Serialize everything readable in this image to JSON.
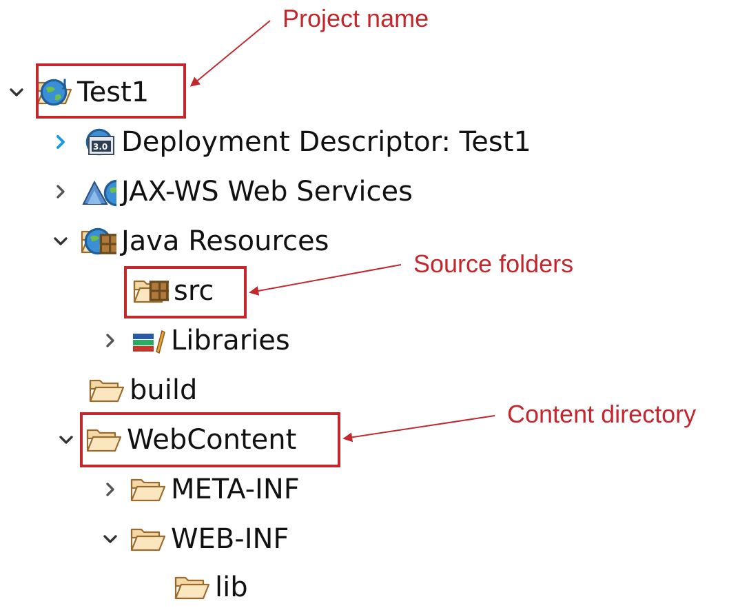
{
  "tree": {
    "items": [
      {
        "label": "Test1",
        "icon": "java-web-project-icon",
        "expander": "expanded"
      },
      {
        "label": "Deployment Descriptor: Test1",
        "icon": "deployment-descriptor-icon",
        "badge": "3.0",
        "expander": "collapsed-active"
      },
      {
        "label": "JAX-WS Web Services",
        "icon": "web-services-icon",
        "expander": "collapsed"
      },
      {
        "label": "Java Resources",
        "icon": "java-resources-icon",
        "expander": "expanded"
      },
      {
        "label": "src",
        "icon": "source-folder-icon",
        "expander": "none"
      },
      {
        "label": "Libraries",
        "icon": "libraries-icon",
        "expander": "collapsed"
      },
      {
        "label": "build",
        "icon": "folder-icon",
        "expander": "none"
      },
      {
        "label": "WebContent",
        "icon": "folder-icon",
        "expander": "expanded"
      },
      {
        "label": "META-INF",
        "icon": "folder-icon",
        "expander": "collapsed"
      },
      {
        "label": "WEB-INF",
        "icon": "folder-icon",
        "expander": "expanded"
      },
      {
        "label": "lib",
        "icon": "folder-icon",
        "expander": "none"
      }
    ]
  },
  "annotations": {
    "project_name": "Project name",
    "source_folders": "Source folders",
    "content_directory": "Content directory"
  },
  "colors": {
    "annotation": "#c1272d",
    "chevron": "#333333",
    "chevron_active": "#1a9be0",
    "folder": "#e8b96a"
  }
}
